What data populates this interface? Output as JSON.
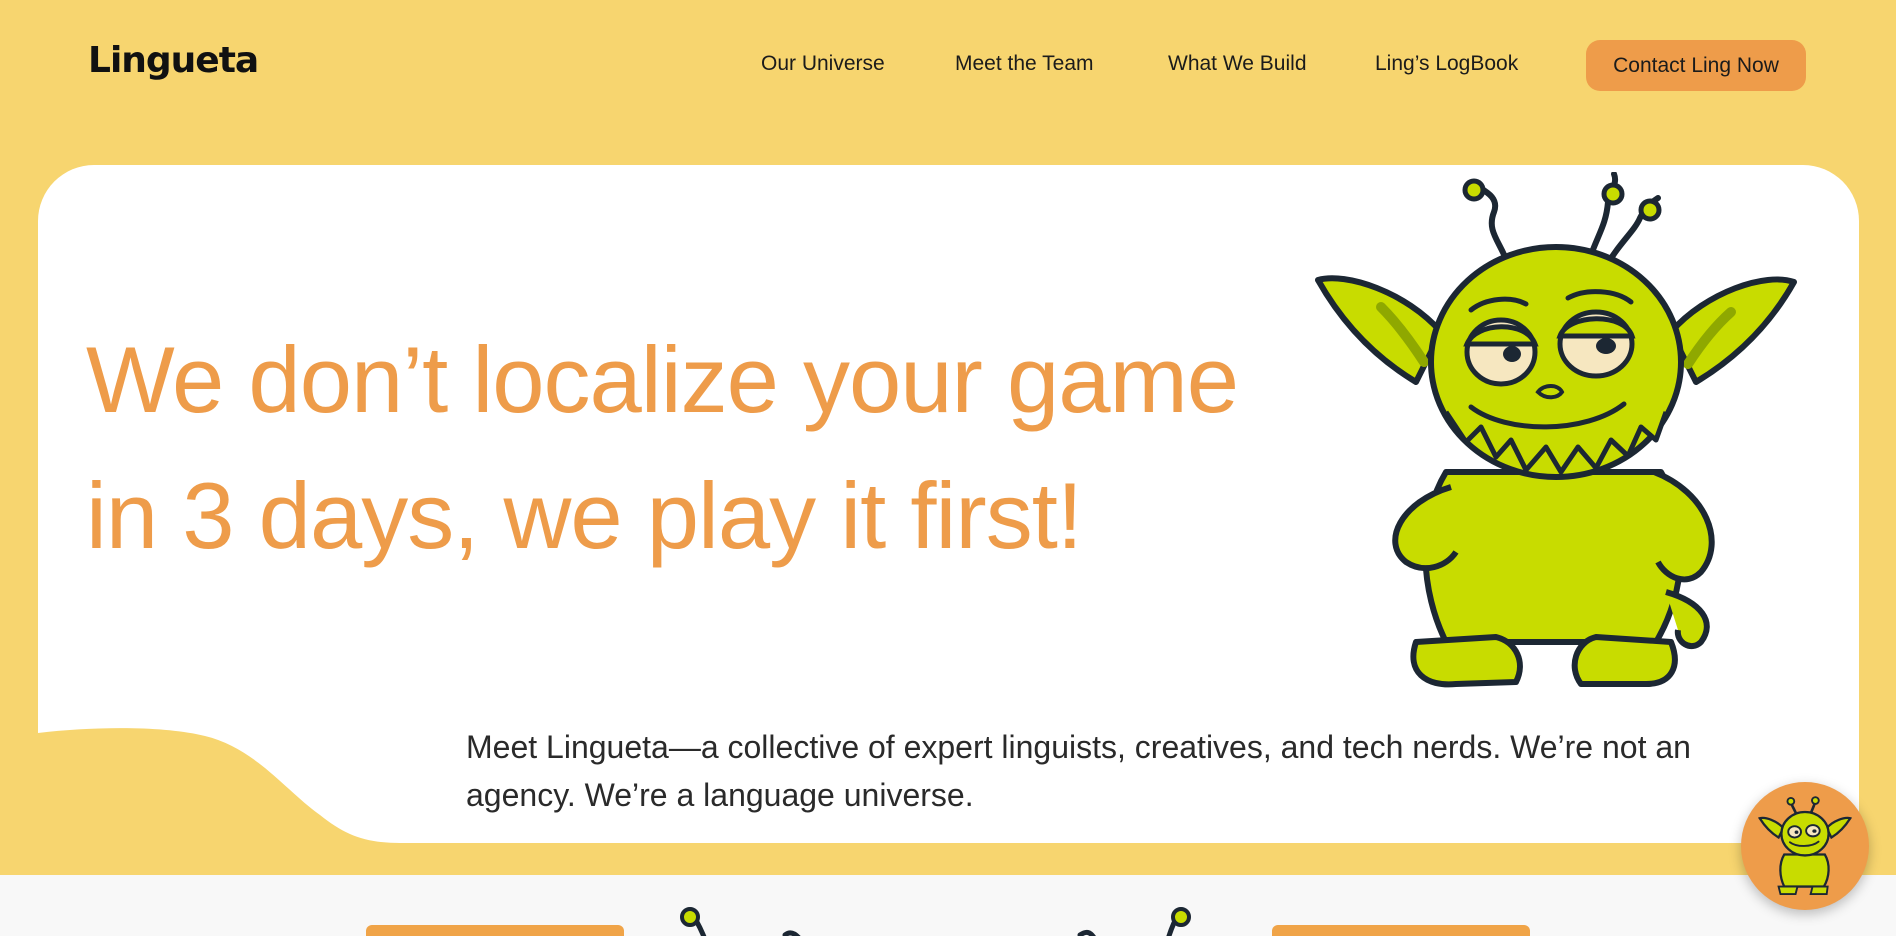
{
  "brand": {
    "logo_text": "Lingueta"
  },
  "nav": {
    "items": [
      {
        "label": "Our Universe"
      },
      {
        "label": "Meet the Team"
      },
      {
        "label": "What We Build"
      },
      {
        "label": "Ling’s LogBook"
      }
    ],
    "cta_label": "Contact Ling Now"
  },
  "hero": {
    "headline_line1": "We don’t localize your game",
    "headline_line2": "in 3 days, we play it first!",
    "intro_line1": "Meet Lingueta—a collective of expert linguists, creatives, and tech nerds. We’re not an",
    "intro_line2": "agency. We’re a language universe."
  },
  "icons": {
    "mascot": "green-alien-mascot-icon",
    "chat": "chat-mascot-icon"
  },
  "colors": {
    "background": "#F7D56F",
    "accent_orange": "#EE9C4A",
    "mascot_green": "#C8DC00",
    "outline": "#1C2733",
    "card": "#FFFFFF"
  }
}
